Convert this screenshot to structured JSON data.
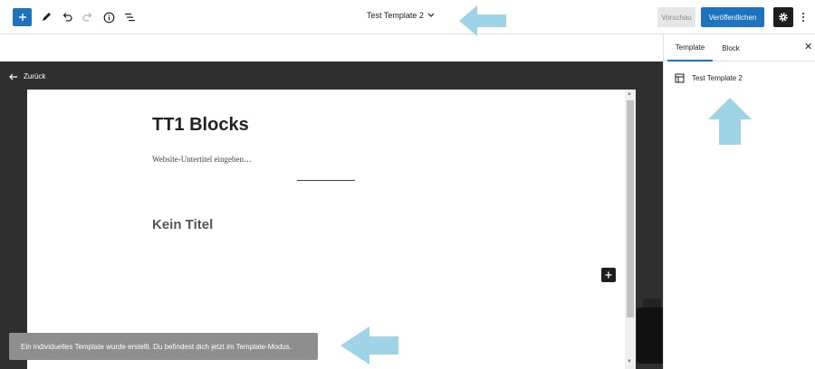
{
  "toolbar": {
    "document_title": "Test Template 2",
    "preview_label": "Vorschau",
    "publish_label": "Veröffentlichen",
    "accent_color": "#1e73be"
  },
  "canvas": {
    "back_label": "Zurück",
    "site_title": "TT1 Blocks",
    "site_tagline": "Website-Untertitel eingeben…",
    "post_title": "Kein Titel"
  },
  "snackbar": {
    "message": "Ein individuelles Template wurde erstellt. Du befindest dich jetzt im Template-Modus."
  },
  "sidebar": {
    "tabs": [
      {
        "label": "Template",
        "active": true
      },
      {
        "label": "Block",
        "active": false
      }
    ],
    "template_name": "Test Template 2"
  },
  "icons": [
    "plus-icon",
    "pencil-icon",
    "undo-icon",
    "redo-icon",
    "info-icon",
    "list-view-icon",
    "chevron-down-icon",
    "gear-icon",
    "more-vertical-icon",
    "arrow-left-icon",
    "close-icon",
    "layout-icon"
  ],
  "annotation_color": "#9fd3e6"
}
